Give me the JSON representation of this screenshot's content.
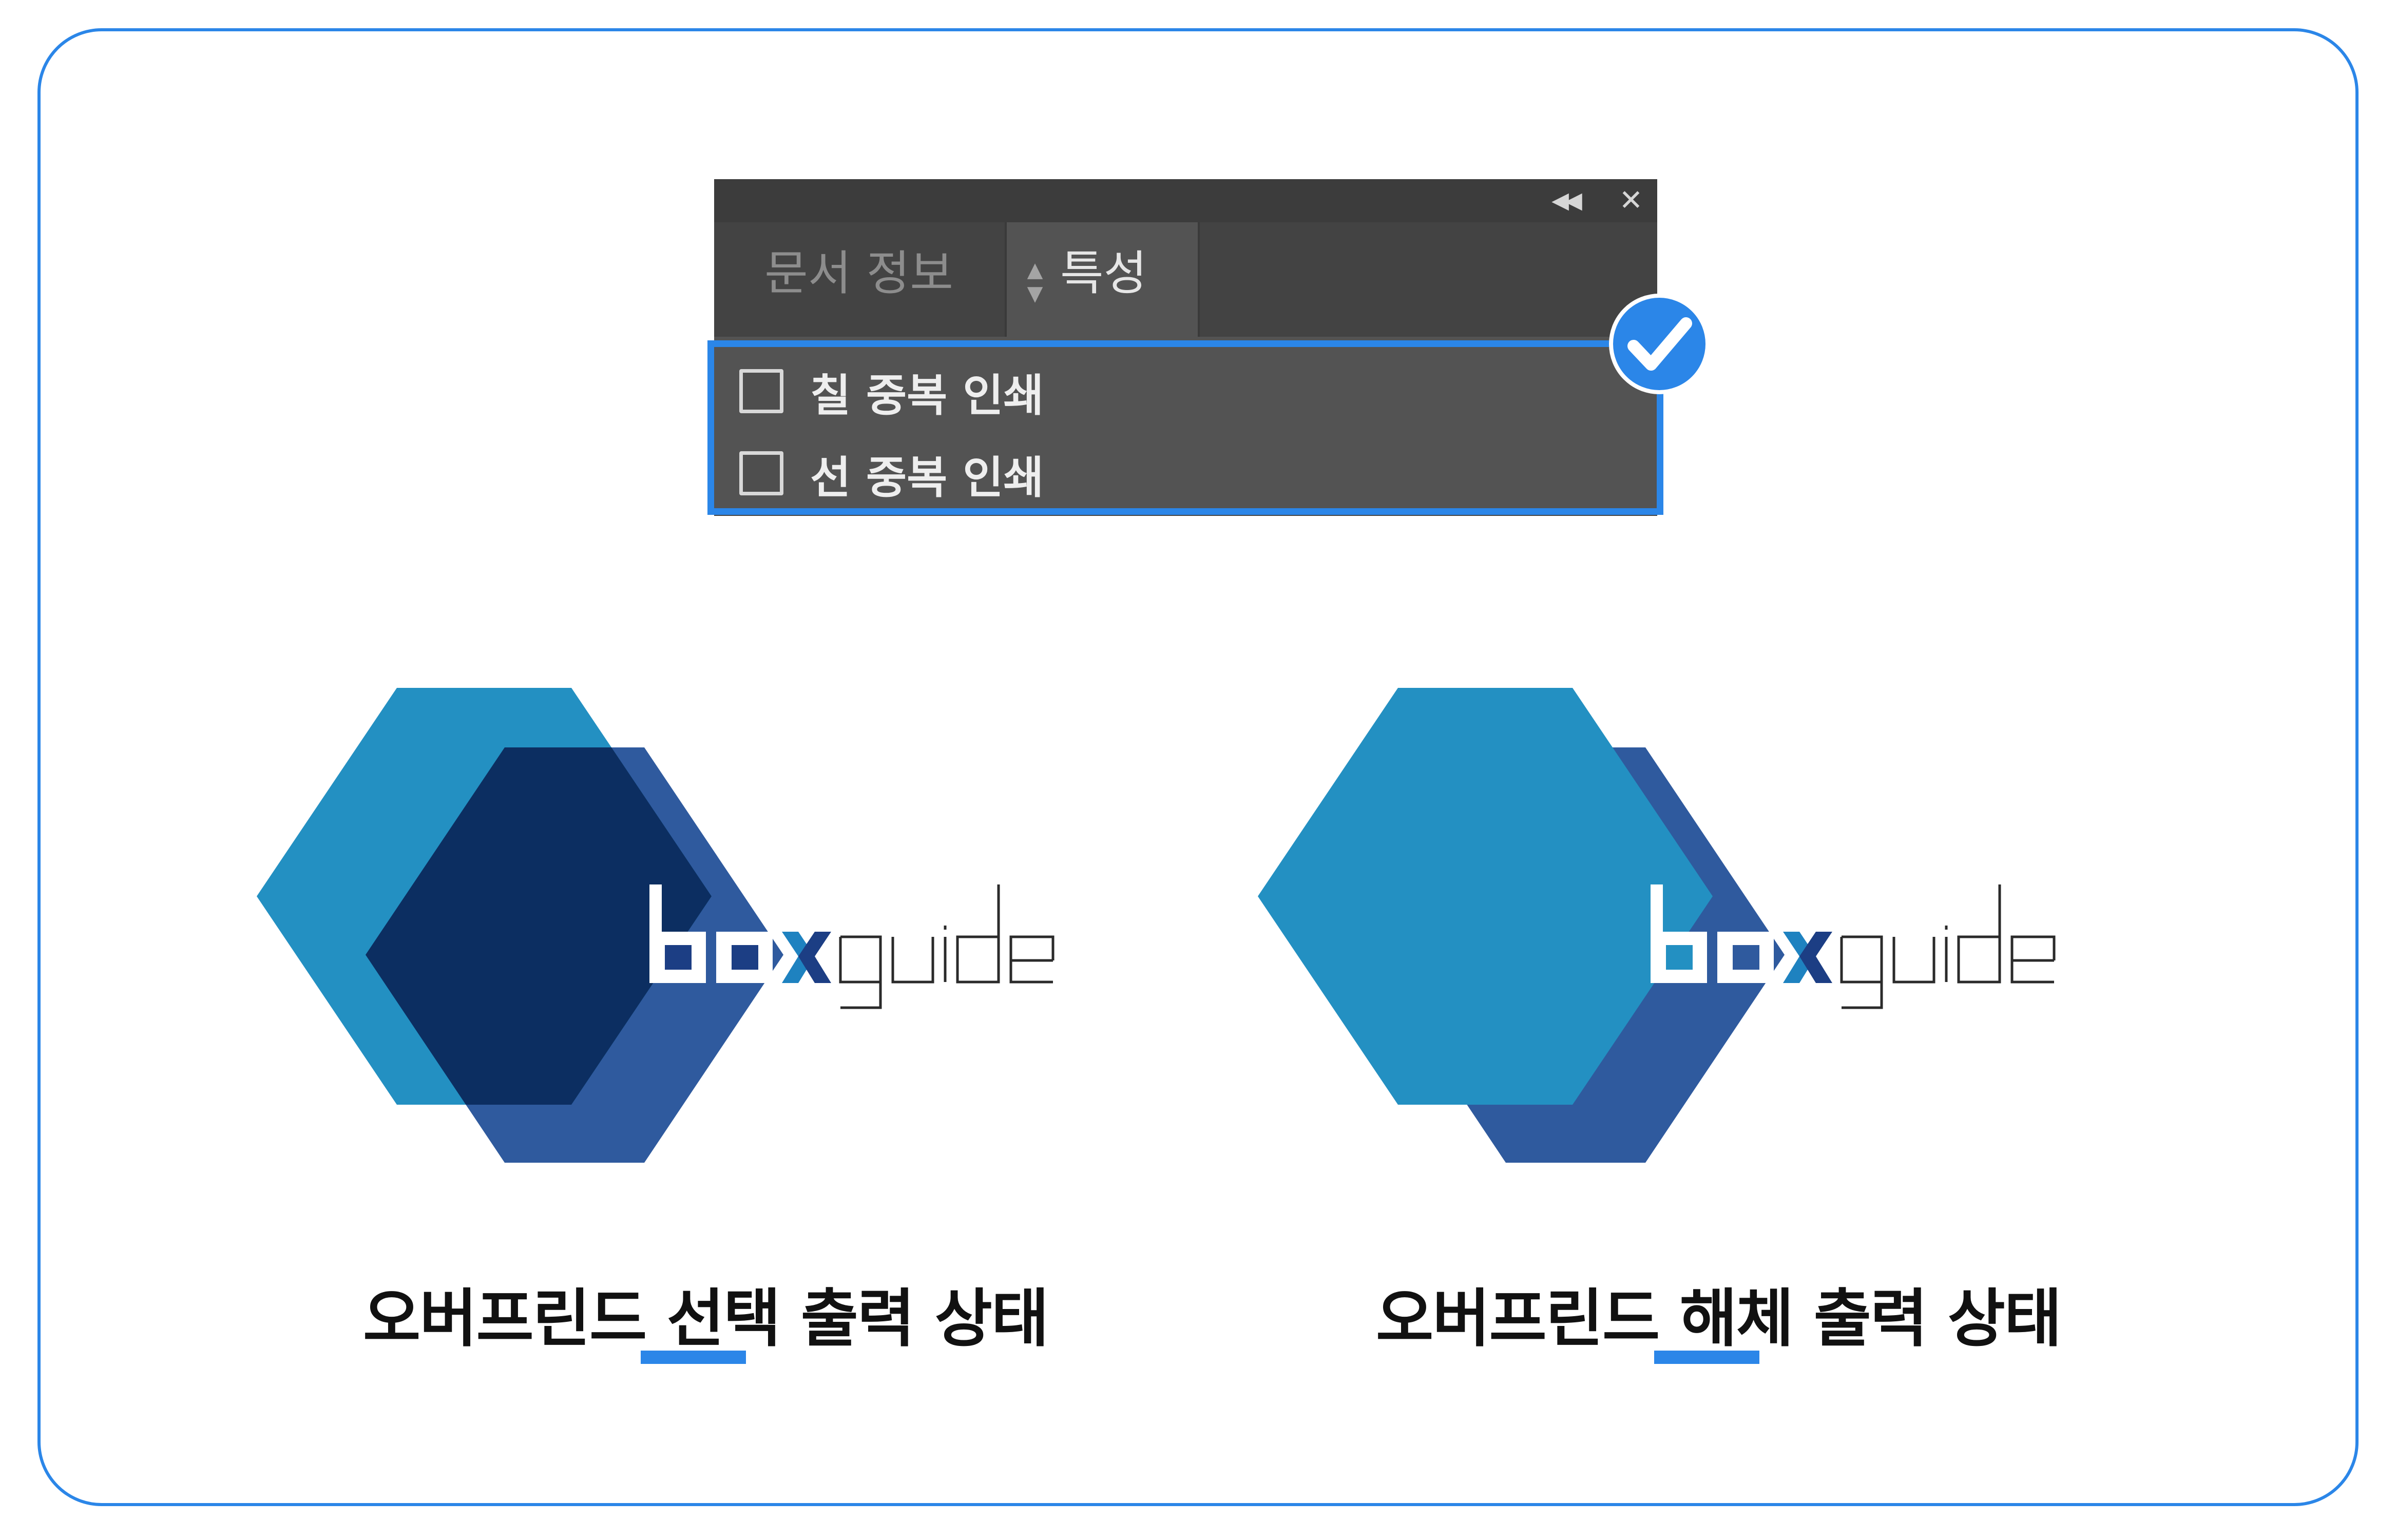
{
  "panel": {
    "tabs": [
      {
        "label": "문서 정보"
      },
      {
        "label": "특성"
      }
    ],
    "options": [
      {
        "label": "칠 중복 인쇄",
        "checked": false
      },
      {
        "label": "선 중복 인쇄",
        "checked": false
      }
    ],
    "icons": {
      "collapse": "double-chevron-left-icon",
      "close": "close-icon",
      "menu": "hamburger-menu-icon",
      "tab_updown": "updown-arrows-icon",
      "badge": "checkmark-icon"
    }
  },
  "logos": [
    {
      "brand_parts": [
        "box",
        "guide"
      ],
      "caption": "오버프린드 선택 출력 상태",
      "overprint": true
    },
    {
      "brand_parts": [
        "box",
        "guide"
      ],
      "caption": "오버프린드 해체 출력 상태",
      "overprint": false
    }
  ],
  "colors": {
    "accent": "#2b86e8",
    "hex_light": "#2390c2",
    "hex_dark": "#2f5a9e",
    "hex_overlap": "#0c2e61",
    "panel_bg": "#535353",
    "panel_titlebar": "#3c3c3c",
    "brand_x_dark": "#1c3e84",
    "brand_x_light": "#1e82c0",
    "wordmark_line": "#2a2a2a"
  }
}
